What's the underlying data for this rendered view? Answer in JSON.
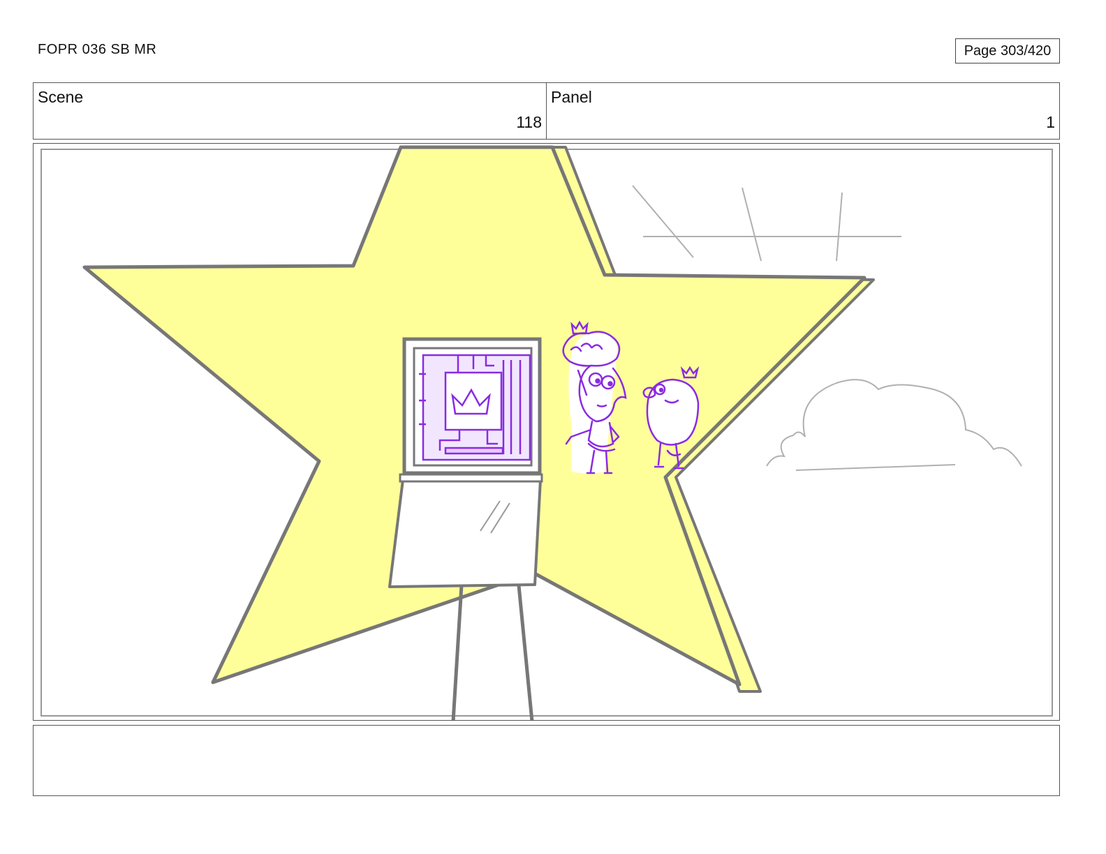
{
  "header": {
    "document_id": "FOPR 036 SB MR",
    "page_label": "Page 303/420"
  },
  "info": {
    "scene_label": "Scene",
    "scene_value": "118",
    "panel_label": "Panel",
    "panel_value": "1"
  },
  "colors": {
    "star_fill": "#ffff9a",
    "outline": "#777777",
    "character_ink": "#8a2be2",
    "sketch_gray": "#b0b0b0"
  },
  "notes": {
    "text": ""
  }
}
